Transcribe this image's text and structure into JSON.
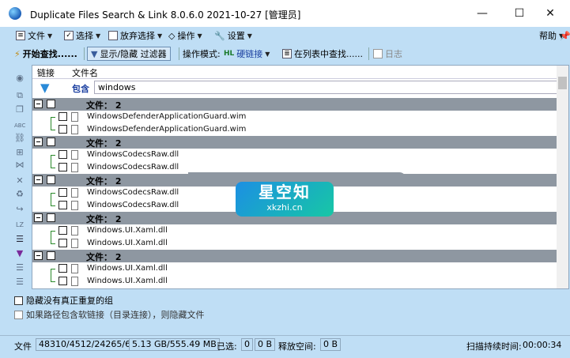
{
  "window": {
    "title": "Duplicate Files Search & Link 8.0.6.0 2021-10-27 [管理员]",
    "minimize": "—",
    "maximize": "☐",
    "close": "✕"
  },
  "menu": {
    "file": "文件",
    "select": "选择",
    "deselect": "放弃选择",
    "action": "操作",
    "settings": "设置",
    "help": "帮助",
    "pin": "📌"
  },
  "toolbar": {
    "start_search": "开始查找......",
    "toggle_filter": "显示/隐藏 过滤器",
    "mode_label": "操作模式:",
    "mode_value": "硬链接",
    "mode_badge": "HL",
    "find_in_list": "在列表中查找......",
    "log": "日志"
  },
  "grid": {
    "col_link": "链接",
    "col_filename": "文件名",
    "filter_label": "包含",
    "filter_value": "windows",
    "groups": [
      {
        "label": "文件： 2",
        "files": [
          "WindowsDefenderApplicationGuard.wim",
          "WindowsDefenderApplicationGuard.wim"
        ]
      },
      {
        "label": "文件： 2",
        "files": [
          "WindowsCodecsRaw.dll",
          "WindowsCodecsRaw.dll"
        ]
      },
      {
        "label": "文件： 2",
        "files": [
          "WindowsCodecsRaw.dll",
          "WindowsCodecsRaw.dll"
        ]
      },
      {
        "label": "文件： 2",
        "files": [
          "Windows.UI.Xaml.dll",
          "Windows.UI.Xaml.dll"
        ]
      },
      {
        "label": "文件： 2",
        "files": [
          "Windows.UI.Xaml.dll",
          "Windows.UI.Xaml.dll"
        ]
      }
    ]
  },
  "options": {
    "hide_no_real_dup": "隐藏没有真正重复的组",
    "hide_soft_links": "如果路径包含软链接（目录连接），则隐藏文件"
  },
  "watermark": {
    "big": "星空知",
    "small": "xkzhi.cn"
  },
  "status": {
    "files_label": "文件",
    "files_value": "48310/4512/24265/6",
    "size_value": "5.13 GB/555.49 MB",
    "selected_label": "已选:",
    "selected_count": "0",
    "selected_size": "0 B",
    "free_label": "释放空间:",
    "free_value": "0 B",
    "scan_label": "扫描持续时间:",
    "scan_value": "00:00:34"
  }
}
